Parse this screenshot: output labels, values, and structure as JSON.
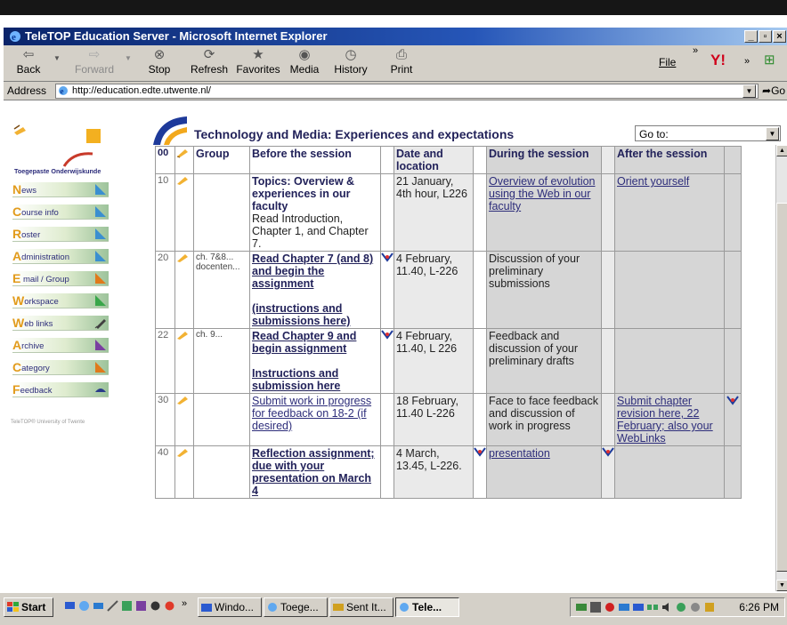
{
  "window": {
    "title": "TeleTOP Education Server - Microsoft Internet Explorer"
  },
  "toolbar": {
    "back": "Back",
    "forward": "Forward",
    "stop": "Stop",
    "refresh": "Refresh",
    "favorites": "Favorites",
    "media": "Media",
    "history": "History",
    "print": "Print",
    "file_menu": "File",
    "chevron": "»"
  },
  "address": {
    "label": "Address",
    "url": "http://education.edte.utwente.nl/",
    "go": "Go"
  },
  "sidebar": {
    "logo_text": "Toegepaste Onderwijskunde",
    "items": [
      {
        "initial": "N",
        "rest": "ews",
        "icon": "news-icon",
        "color": "#3a8fd0"
      },
      {
        "initial": "C",
        "rest": "ourse info",
        "icon": "course-info-icon",
        "color": "#3a8fd0"
      },
      {
        "initial": "R",
        "rest": "oster",
        "icon": "roster-icon",
        "color": "#3a8fd0"
      },
      {
        "initial": "A",
        "rest": "dministration",
        "icon": "administration-icon",
        "color": "#3a8fd0"
      },
      {
        "initial": "E",
        "rest": " mail / Group",
        "icon": "email-group-icon",
        "color": "#e07a1c"
      },
      {
        "initial": "W",
        "rest": "orkspace",
        "icon": "workspace-icon",
        "color": "#39a64a"
      },
      {
        "initial": "W",
        "rest": "eb links",
        "icon": "pen-icon",
        "color": "#404040"
      },
      {
        "initial": "A",
        "rest": "rchive",
        "icon": "archive-icon",
        "color": "#7a3fa0"
      },
      {
        "initial": "C",
        "rest": "ategory",
        "icon": "category-icon",
        "color": "#e07a1c"
      },
      {
        "initial": "F",
        "rest": "eedback",
        "icon": "eye-icon",
        "color": "#2a3b8a"
      }
    ],
    "footer": "TeleTOP® University of Twente"
  },
  "page": {
    "title": "Technology and Media: Experiences and expectations",
    "goto": "Go to:"
  },
  "table": {
    "headers": {
      "num": "00",
      "group": "Group",
      "before": "Before the session",
      "date": "Date and location",
      "during": "During the session",
      "after": "After the session"
    },
    "rows": [
      {
        "num": "10",
        "group": "",
        "before_title": "Topics: Overview & experiences in our faculty",
        "before_text": "Read Introduction, Chapter 1, and Chapter 7.",
        "date": "21 January, 4th hour, L226",
        "during": "Overview of evolution using the Web in our faculty",
        "after": "Orient yourself"
      },
      {
        "num": "20",
        "group": "ch. 7&8... docenten...",
        "before_title": "Read Chapter 7 (and 8) and begin the assignment",
        "before_link2": "(instructions and submissions here)",
        "date": "4 February, 11.40, L-226",
        "during": "Discussion of your preliminary submissions",
        "after": ""
      },
      {
        "num": "22",
        "group": "ch. 9...",
        "before_title": "Read Chapter 9 and begin assignment",
        "before_link2": "Instructions and submission here",
        "date": "4 February, 11.40, L 226",
        "during": "Feedback and discussion of your preliminary drafts",
        "after": ""
      },
      {
        "num": "30",
        "group": "",
        "before_link": "Submit work in progress for feedback on 18-2 (if desired)",
        "date": "18 February, 11.40 L-226",
        "during": "Face to face feedback and discussion of work in progress",
        "after": "Submit chapter revision here, 22 February; also your WebLinks"
      },
      {
        "num": "40",
        "group": "",
        "before_title": "Reflection assignment; due with your presentation on March 4",
        "date": "4 March, 13.45, L-226.",
        "during": "presentation",
        "after": ""
      }
    ]
  },
  "taskbar": {
    "start": "Start",
    "chevron": "»",
    "tasks": [
      "Windo...",
      "Toege...",
      "Sent It...",
      "Tele..."
    ],
    "clock": "6:26 PM"
  },
  "colors": {
    "title_bar": "#0a246a",
    "chrome": "#d4d0c8",
    "heading": "#22225a",
    "cell_gray": "#d6d6d6"
  }
}
